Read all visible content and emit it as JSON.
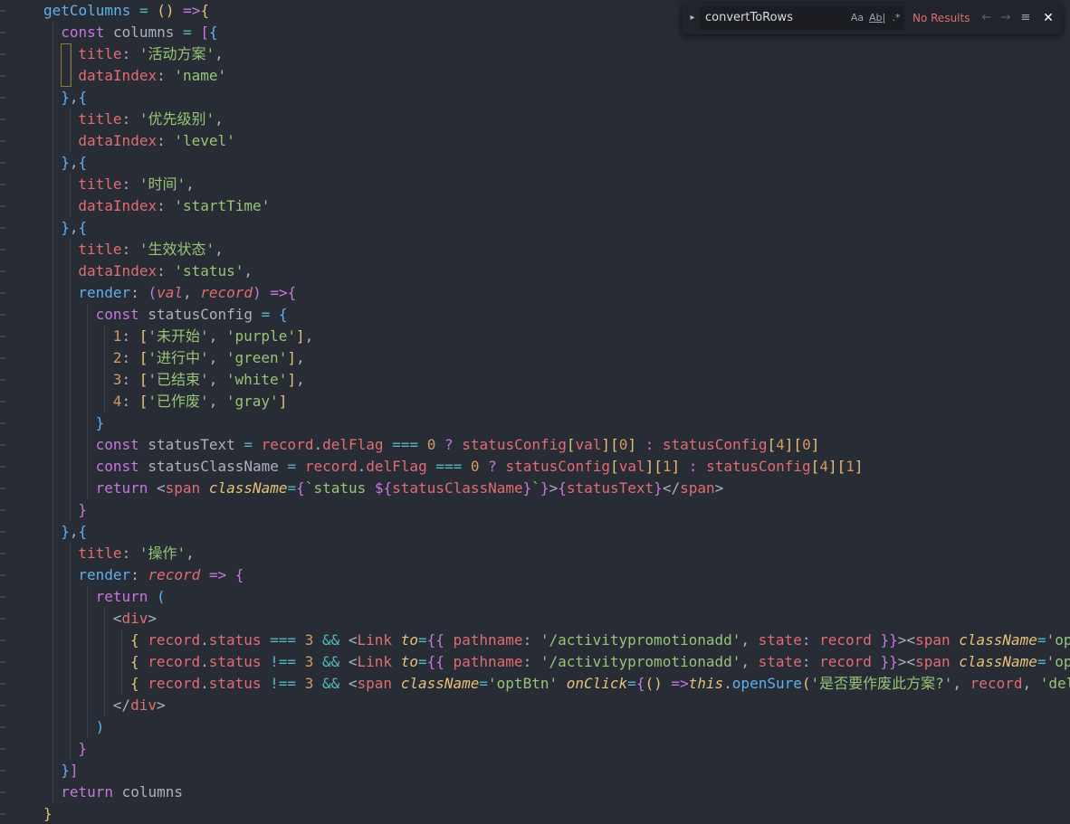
{
  "find_widget": {
    "query": "convertToRows",
    "match_case_label": "Aa",
    "whole_word_label": "Ab|",
    "regex_label": ".*",
    "results_text": "No Results",
    "prev_icon": "←",
    "next_icon": "→",
    "selection_icon": "≡",
    "close_icon": "✕",
    "toggle_icon": "▸"
  },
  "code_lines": [
    [
      [
        "fn",
        "getColumns"
      ],
      [
        "pun",
        " "
      ],
      [
        "op",
        "="
      ],
      [
        "pun",
        " "
      ],
      [
        "b1",
        "("
      ],
      [
        "b1",
        ")"
      ],
      [
        "pun",
        " "
      ],
      [
        "kw",
        "=>"
      ],
      [
        "b1",
        "{"
      ]
    ],
    [
      [
        "kw",
        "const"
      ],
      [
        "pun",
        " "
      ],
      [
        "var",
        "columns"
      ],
      [
        "pun",
        " "
      ],
      [
        "op",
        "="
      ],
      [
        "pun",
        " "
      ],
      [
        "b2",
        "["
      ],
      [
        "b3",
        "{"
      ]
    ],
    [
      [
        "prop",
        "title"
      ],
      [
        "pun",
        ": "
      ],
      [
        "str",
        "'活动方案'"
      ],
      [
        "pun",
        ","
      ]
    ],
    [
      [
        "prop",
        "dataIndex"
      ],
      [
        "pun",
        ": "
      ],
      [
        "str",
        "'name'"
      ]
    ],
    [
      [
        "b3",
        "}"
      ],
      [
        "pun",
        ","
      ],
      [
        "b3",
        "{"
      ]
    ],
    [
      [
        "prop",
        "title"
      ],
      [
        "pun",
        ": "
      ],
      [
        "str",
        "'优先级别'"
      ],
      [
        "pun",
        ","
      ]
    ],
    [
      [
        "prop",
        "dataIndex"
      ],
      [
        "pun",
        ": "
      ],
      [
        "str",
        "'level'"
      ]
    ],
    [
      [
        "b3",
        "}"
      ],
      [
        "pun",
        ","
      ],
      [
        "b3",
        "{"
      ]
    ],
    [
      [
        "prop",
        "title"
      ],
      [
        "pun",
        ": "
      ],
      [
        "str",
        "'时间'"
      ],
      [
        "pun",
        ","
      ]
    ],
    [
      [
        "prop",
        "dataIndex"
      ],
      [
        "pun",
        ": "
      ],
      [
        "str",
        "'startTime'"
      ]
    ],
    [
      [
        "b3",
        "}"
      ],
      [
        "pun",
        ","
      ],
      [
        "b3",
        "{"
      ]
    ],
    [
      [
        "prop",
        "title"
      ],
      [
        "pun",
        ": "
      ],
      [
        "str",
        "'生效状态'"
      ],
      [
        "pun",
        ","
      ]
    ],
    [
      [
        "prop",
        "dataIndex"
      ],
      [
        "pun",
        ": "
      ],
      [
        "str",
        "'status'"
      ],
      [
        "pun",
        ","
      ]
    ],
    [
      [
        "fn",
        "render"
      ],
      [
        "pun",
        ": "
      ],
      [
        "kw",
        "("
      ],
      [
        "par",
        "val"
      ],
      [
        "pun",
        ", "
      ],
      [
        "par",
        "record"
      ],
      [
        "kw",
        ")"
      ],
      [
        "pun",
        " "
      ],
      [
        "kw",
        "=>"
      ],
      [
        "kw",
        "{"
      ]
    ],
    [
      [
        "kw",
        "const"
      ],
      [
        "pun",
        " "
      ],
      [
        "var",
        "statusConfig"
      ],
      [
        "pun",
        " "
      ],
      [
        "op",
        "="
      ],
      [
        "pun",
        " "
      ],
      [
        "b3",
        "{"
      ]
    ],
    [
      [
        "num",
        "1"
      ],
      [
        "pun",
        ": "
      ],
      [
        "b1",
        "["
      ],
      [
        "str",
        "'未开始'"
      ],
      [
        "pun",
        ", "
      ],
      [
        "str",
        "'purple'"
      ],
      [
        "b1",
        "]"
      ],
      [
        "pun",
        ","
      ]
    ],
    [
      [
        "num",
        "2"
      ],
      [
        "pun",
        ": "
      ],
      [
        "b1",
        "["
      ],
      [
        "str",
        "'进行中'"
      ],
      [
        "pun",
        ", "
      ],
      [
        "str",
        "'green'"
      ],
      [
        "b1",
        "]"
      ],
      [
        "pun",
        ","
      ]
    ],
    [
      [
        "num",
        "3"
      ],
      [
        "pun",
        ": "
      ],
      [
        "b1",
        "["
      ],
      [
        "str",
        "'已结束'"
      ],
      [
        "pun",
        ", "
      ],
      [
        "str",
        "'white'"
      ],
      [
        "b1",
        "]"
      ],
      [
        "pun",
        ","
      ]
    ],
    [
      [
        "num",
        "4"
      ],
      [
        "pun",
        ": "
      ],
      [
        "b1",
        "["
      ],
      [
        "str",
        "'已作废'"
      ],
      [
        "pun",
        ", "
      ],
      [
        "str",
        "'gray'"
      ],
      [
        "b1",
        "]"
      ]
    ],
    [
      [
        "b3",
        "}"
      ]
    ],
    [
      [
        "kw",
        "const"
      ],
      [
        "pun",
        " "
      ],
      [
        "var",
        "statusText"
      ],
      [
        "pun",
        " "
      ],
      [
        "op",
        "="
      ],
      [
        "pun",
        " "
      ],
      [
        "prop",
        "record"
      ],
      [
        "pun",
        "."
      ],
      [
        "prop",
        "delFlag"
      ],
      [
        "pun",
        " "
      ],
      [
        "op",
        "==="
      ],
      [
        "pun",
        " "
      ],
      [
        "num",
        "0"
      ],
      [
        "pun",
        " "
      ],
      [
        "kw",
        "?"
      ],
      [
        "pun",
        " "
      ],
      [
        "prop",
        "statusConfig"
      ],
      [
        "b1",
        "["
      ],
      [
        "prop",
        "val"
      ],
      [
        "b1",
        "]"
      ],
      [
        "b1",
        "["
      ],
      [
        "num",
        "0"
      ],
      [
        "b1",
        "]"
      ],
      [
        "pun",
        " "
      ],
      [
        "kw",
        ":"
      ],
      [
        "pun",
        " "
      ],
      [
        "prop",
        "statusConfig"
      ],
      [
        "b1",
        "["
      ],
      [
        "num",
        "4"
      ],
      [
        "b1",
        "]"
      ],
      [
        "b1",
        "["
      ],
      [
        "num",
        "0"
      ],
      [
        "b1",
        "]"
      ]
    ],
    [
      [
        "kw",
        "const"
      ],
      [
        "pun",
        " "
      ],
      [
        "var",
        "statusClassName"
      ],
      [
        "pun",
        " "
      ],
      [
        "op",
        "="
      ],
      [
        "pun",
        " "
      ],
      [
        "prop",
        "record"
      ],
      [
        "pun",
        "."
      ],
      [
        "prop",
        "delFlag"
      ],
      [
        "pun",
        " "
      ],
      [
        "op",
        "==="
      ],
      [
        "pun",
        " "
      ],
      [
        "num",
        "0"
      ],
      [
        "pun",
        " "
      ],
      [
        "kw",
        "?"
      ],
      [
        "pun",
        " "
      ],
      [
        "prop",
        "statusConfig"
      ],
      [
        "b1",
        "["
      ],
      [
        "prop",
        "val"
      ],
      [
        "b1",
        "]"
      ],
      [
        "b1",
        "["
      ],
      [
        "num",
        "1"
      ],
      [
        "b1",
        "]"
      ],
      [
        "pun",
        " "
      ],
      [
        "kw",
        ":"
      ],
      [
        "pun",
        " "
      ],
      [
        "prop",
        "statusConfig"
      ],
      [
        "b1",
        "["
      ],
      [
        "num",
        "4"
      ],
      [
        "b1",
        "]"
      ],
      [
        "b1",
        "["
      ],
      [
        "num",
        "1"
      ],
      [
        "b1",
        "]"
      ]
    ],
    [
      [
        "kw",
        "return"
      ],
      [
        "pun",
        " <"
      ],
      [
        "tag",
        "span"
      ],
      [
        "pun",
        " "
      ],
      [
        "jsxattr",
        "className"
      ],
      [
        "op",
        "="
      ],
      [
        "kw",
        "{"
      ],
      [
        "str",
        "`status "
      ],
      [
        "kw",
        "${"
      ],
      [
        "prop",
        "statusClassName"
      ],
      [
        "kw",
        "}"
      ],
      [
        "str",
        "`"
      ],
      [
        "kw",
        "}"
      ],
      [
        "pun",
        ">"
      ],
      [
        "kw",
        "{"
      ],
      [
        "prop",
        "statusText"
      ],
      [
        "kw",
        "}"
      ],
      [
        "pun",
        "</"
      ],
      [
        "tag",
        "span"
      ],
      [
        "pun",
        ">"
      ]
    ],
    [
      [
        "kw",
        "}"
      ]
    ],
    [
      [
        "b3",
        "}"
      ],
      [
        "pun",
        ","
      ],
      [
        "b3",
        "{"
      ]
    ],
    [
      [
        "prop",
        "title"
      ],
      [
        "pun",
        ": "
      ],
      [
        "str",
        "'操作'"
      ],
      [
        "pun",
        ","
      ]
    ],
    [
      [
        "fn",
        "render"
      ],
      [
        "pun",
        ": "
      ],
      [
        "par",
        "record"
      ],
      [
        "pun",
        " "
      ],
      [
        "kw",
        "=>"
      ],
      [
        "pun",
        " "
      ],
      [
        "kw",
        "{"
      ]
    ],
    [
      [
        "kw",
        "return"
      ],
      [
        "pun",
        " "
      ],
      [
        "b3",
        "("
      ]
    ],
    [
      [
        "pun",
        "<"
      ],
      [
        "tag",
        "div"
      ],
      [
        "pun",
        ">"
      ]
    ],
    [
      [
        "b1",
        "{"
      ],
      [
        "pun",
        " "
      ],
      [
        "prop",
        "record"
      ],
      [
        "pun",
        "."
      ],
      [
        "prop",
        "status"
      ],
      [
        "pun",
        " "
      ],
      [
        "op",
        "==="
      ],
      [
        "pun",
        " "
      ],
      [
        "num",
        "3"
      ],
      [
        "pun",
        " "
      ],
      [
        "op",
        "&&"
      ],
      [
        "pun",
        " <"
      ],
      [
        "tag",
        "Link"
      ],
      [
        "pun",
        " "
      ],
      [
        "jsxattr",
        "to"
      ],
      [
        "op",
        "="
      ],
      [
        "kw",
        "{{"
      ],
      [
        "pun",
        " "
      ],
      [
        "prop",
        "pathname"
      ],
      [
        "pun",
        ": "
      ],
      [
        "str",
        "'/activitypromotionadd'"
      ],
      [
        "pun",
        ", "
      ],
      [
        "prop",
        "state"
      ],
      [
        "pun",
        ": "
      ],
      [
        "prop",
        "record"
      ],
      [
        "pun",
        " "
      ],
      [
        "kw",
        "}}"
      ],
      [
        "pun",
        "><"
      ],
      [
        "tag",
        "span"
      ],
      [
        "pun",
        " "
      ],
      [
        "jsxattr",
        "className"
      ],
      [
        "op",
        "="
      ],
      [
        "str",
        "'op"
      ]
    ],
    [
      [
        "b1",
        "{"
      ],
      [
        "pun",
        " "
      ],
      [
        "prop",
        "record"
      ],
      [
        "pun",
        "."
      ],
      [
        "prop",
        "status"
      ],
      [
        "pun",
        " "
      ],
      [
        "op",
        "!=="
      ],
      [
        "pun",
        " "
      ],
      [
        "num",
        "3"
      ],
      [
        "pun",
        " "
      ],
      [
        "op",
        "&&"
      ],
      [
        "pun",
        " <"
      ],
      [
        "tag",
        "Link"
      ],
      [
        "pun",
        " "
      ],
      [
        "jsxattr",
        "to"
      ],
      [
        "op",
        "="
      ],
      [
        "kw",
        "{{"
      ],
      [
        "pun",
        " "
      ],
      [
        "prop",
        "pathname"
      ],
      [
        "pun",
        ": "
      ],
      [
        "str",
        "'/activitypromotionadd'"
      ],
      [
        "pun",
        ", "
      ],
      [
        "prop",
        "state"
      ],
      [
        "pun",
        ": "
      ],
      [
        "prop",
        "record"
      ],
      [
        "pun",
        " "
      ],
      [
        "kw",
        "}}"
      ],
      [
        "pun",
        "><"
      ],
      [
        "tag",
        "span"
      ],
      [
        "pun",
        " "
      ],
      [
        "jsxattr",
        "className"
      ],
      [
        "op",
        "="
      ],
      [
        "str",
        "'op"
      ]
    ],
    [
      [
        "b1",
        "{"
      ],
      [
        "pun",
        " "
      ],
      [
        "prop",
        "record"
      ],
      [
        "pun",
        "."
      ],
      [
        "prop",
        "status"
      ],
      [
        "pun",
        " "
      ],
      [
        "op",
        "!=="
      ],
      [
        "pun",
        " "
      ],
      [
        "num",
        "3"
      ],
      [
        "pun",
        " "
      ],
      [
        "op",
        "&&"
      ],
      [
        "pun",
        " <"
      ],
      [
        "tag",
        "span"
      ],
      [
        "pun",
        " "
      ],
      [
        "jsxattr",
        "className"
      ],
      [
        "op",
        "="
      ],
      [
        "str",
        "'optBtn'"
      ],
      [
        "pun",
        " "
      ],
      [
        "jsxattr",
        "onClick"
      ],
      [
        "op",
        "="
      ],
      [
        "kw",
        "{"
      ],
      [
        "b1",
        "()"
      ],
      [
        "pun",
        " "
      ],
      [
        "kw",
        "=>"
      ],
      [
        "it",
        "this"
      ],
      [
        "pun",
        "."
      ],
      [
        "fn",
        "openSure"
      ],
      [
        "b1",
        "("
      ],
      [
        "str",
        "'是否要作废此方案?'"
      ],
      [
        "pun",
        ", "
      ],
      [
        "prop",
        "record"
      ],
      [
        "pun",
        ", "
      ],
      [
        "str",
        "'del"
      ]
    ],
    [
      [
        "pun",
        "</"
      ],
      [
        "tag",
        "div"
      ],
      [
        "pun",
        ">"
      ]
    ],
    [
      [
        "b3",
        ")"
      ]
    ],
    [
      [
        "kw",
        "}"
      ]
    ],
    [
      [
        "b3",
        "}"
      ],
      [
        "b2",
        "]"
      ]
    ],
    [
      [
        "kw",
        "return"
      ],
      [
        "pun",
        " "
      ],
      [
        "var",
        "columns"
      ]
    ],
    [
      [
        "b1",
        "}"
      ]
    ]
  ]
}
